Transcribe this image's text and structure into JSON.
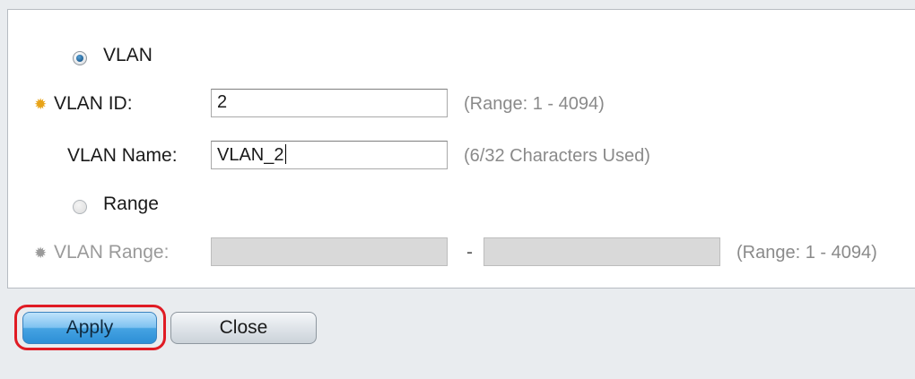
{
  "form": {
    "vlan_option_label": "VLAN",
    "vlan_option_checked": true,
    "vlan_id_label": "VLAN ID:",
    "vlan_id_value": "2",
    "vlan_id_hint": "(Range: 1 - 4094)",
    "vlan_name_label": "VLAN Name:",
    "vlan_name_value": "VLAN_2",
    "vlan_name_hint": "(6/32 Characters Used)",
    "range_option_label": "Range",
    "range_option_checked": false,
    "vlan_range_label": "VLAN Range:",
    "vlan_range_from_value": "",
    "vlan_range_separator": "-",
    "vlan_range_to_value": "",
    "vlan_range_hint": "(Range: 1 - 4094)"
  },
  "buttons": {
    "apply_label": "Apply",
    "close_label": "Close"
  },
  "icons": {
    "required_active": "required-gear-icon",
    "required_disabled": "required-gear-icon-disabled"
  },
  "colors": {
    "required_icon_active": "#e8a317",
    "required_icon_disabled": "#9a9a9a",
    "highlight": "#e01b24",
    "apply_button": "#45a3e2"
  }
}
